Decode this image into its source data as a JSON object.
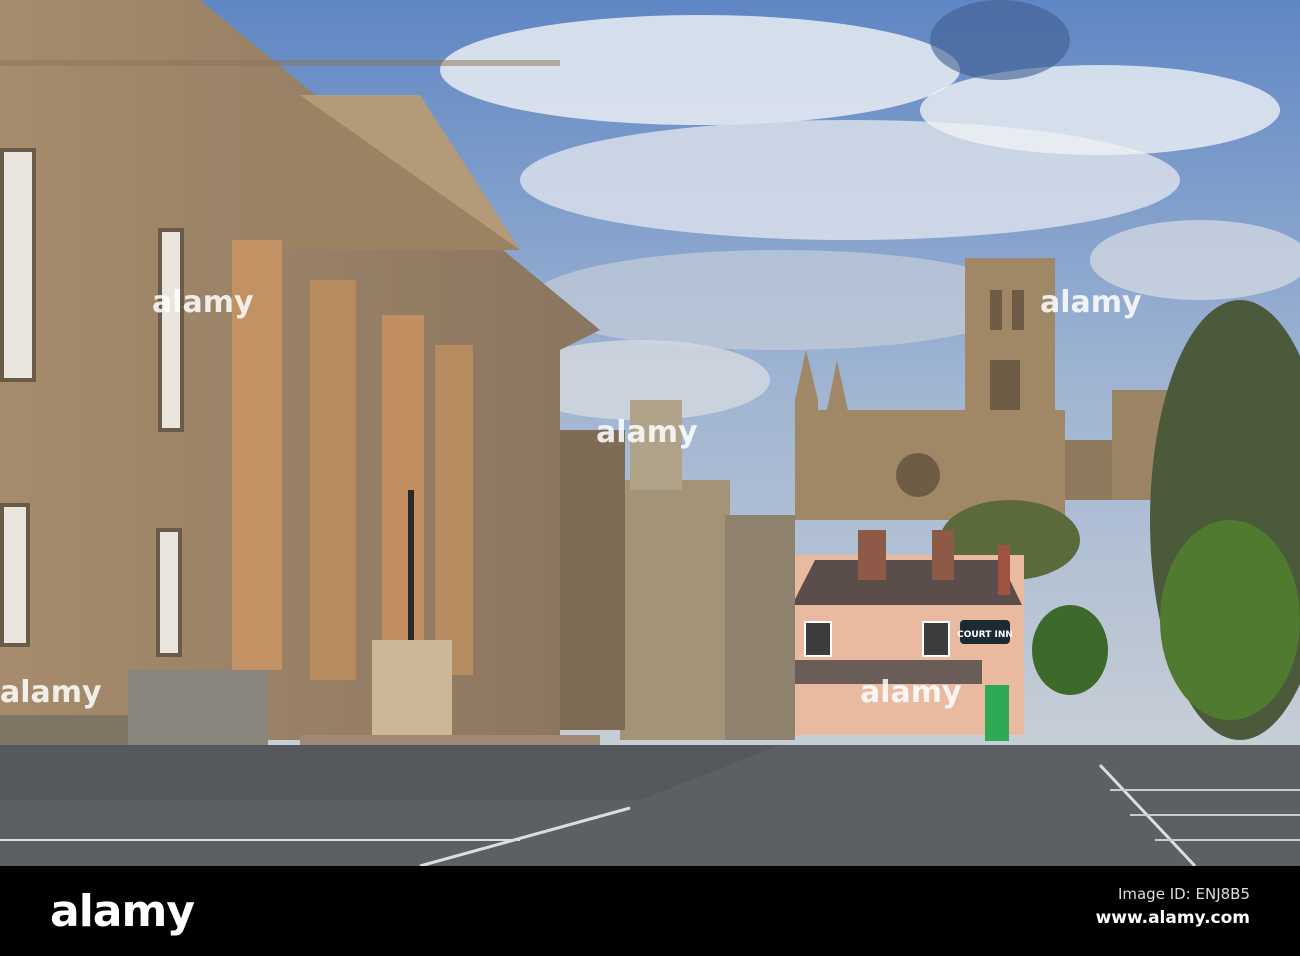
{
  "photo": {
    "subject": "Durham Cathedral seen from a street beside a columned court building",
    "sign_text": "COURT INN",
    "watermark": "alamy"
  },
  "footer": {
    "logo": "alamy",
    "image_id": "Image ID: ENJ8B5",
    "url": "www.alamy.com"
  },
  "colors": {
    "sky": "#7fa3d3",
    "stone": "#b39a78",
    "road": "#55585d",
    "inn": "#e9b9a0"
  }
}
